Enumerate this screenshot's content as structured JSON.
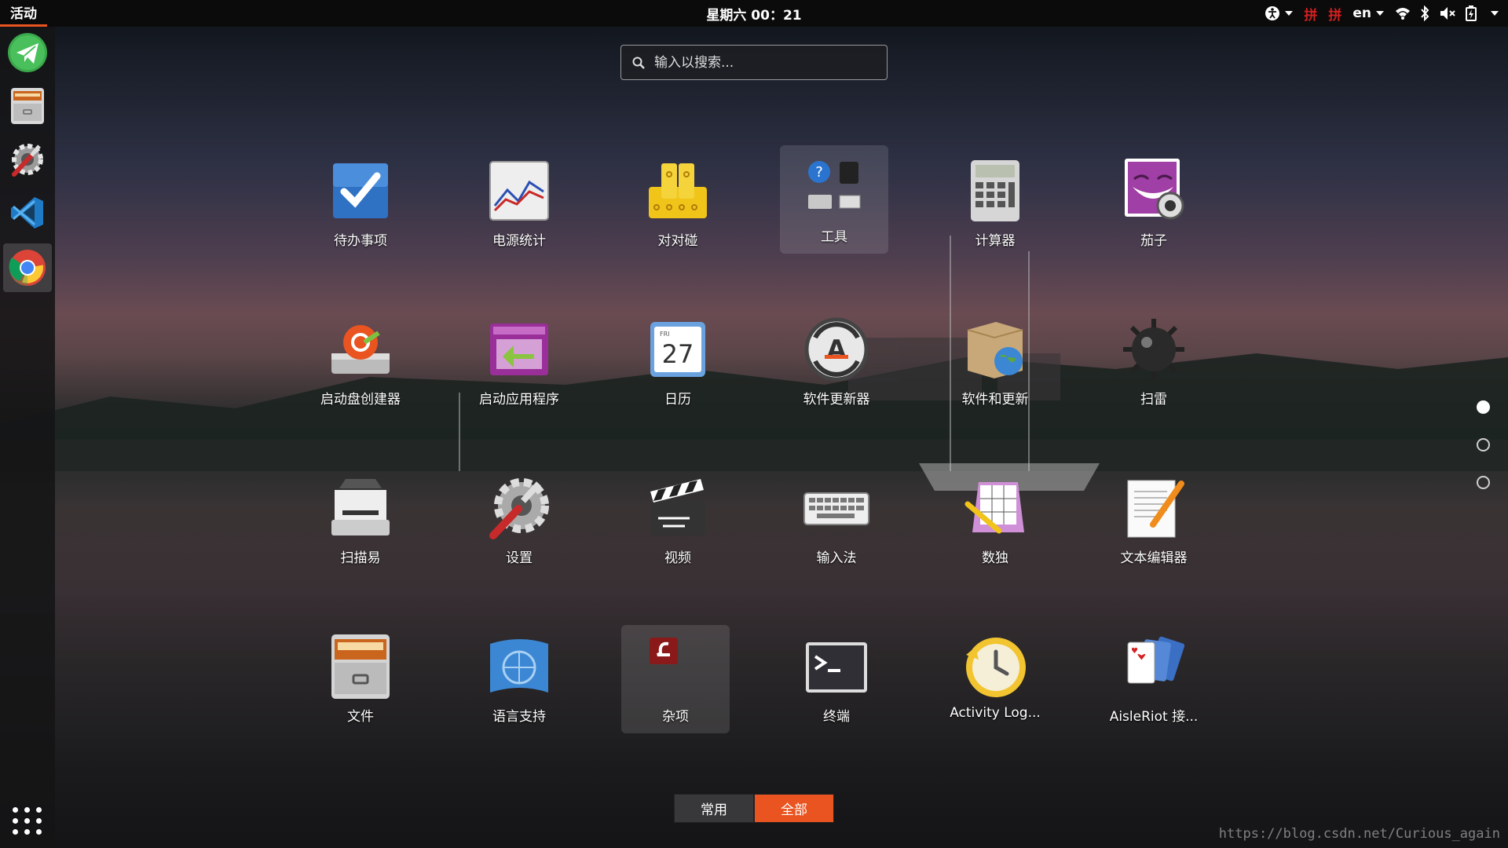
{
  "topbar": {
    "activities": "活动",
    "clock": "星期六 00：21",
    "pinyin_1": "拼",
    "pinyin_2": "拼",
    "language": "en"
  },
  "search": {
    "placeholder": "输入以搜索..."
  },
  "dock": {
    "items": [
      "telegram-icon",
      "file-cabinet-icon",
      "system-tools-icon",
      "vscode-icon",
      "chrome-icon"
    ],
    "active_index": 4
  },
  "apps": [
    {
      "label": "待办事项",
      "icon": "todo-icon"
    },
    {
      "label": "电源统计",
      "icon": "power-statistics-icon"
    },
    {
      "label": "对对碰",
      "icon": "swell-foop-icon"
    },
    {
      "label": "工具",
      "icon": "utilities-folder-icon",
      "highlighted": true
    },
    {
      "label": "计算器",
      "icon": "calculator-icon"
    },
    {
      "label": "茄子",
      "icon": "cheese-icon"
    },
    {
      "label": "启动盘创建器",
      "icon": "startup-disk-creator-icon"
    },
    {
      "label": "启动应用程序",
      "icon": "startup-applications-icon"
    },
    {
      "label": "日历",
      "icon": "calendar-icon",
      "day": "27",
      "weekday": "FRI"
    },
    {
      "label": "软件更新器",
      "icon": "software-updater-icon"
    },
    {
      "label": "软件和更新",
      "icon": "software-properties-icon"
    },
    {
      "label": "扫雷",
      "icon": "mines-icon"
    },
    {
      "label": "扫描易",
      "icon": "scanner-icon"
    },
    {
      "label": "设置",
      "icon": "settings-icon"
    },
    {
      "label": "视频",
      "icon": "video-clapperboard-icon"
    },
    {
      "label": "输入法",
      "icon": "keyboard-icon"
    },
    {
      "label": "数独",
      "icon": "sudoku-icon"
    },
    {
      "label": "文本编辑器",
      "icon": "text-editor-icon"
    },
    {
      "label": "文件",
      "icon": "files-icon"
    },
    {
      "label": "语言支持",
      "icon": "language-support-icon"
    },
    {
      "label": "杂项",
      "icon": "misc-folder-icon",
      "highlighted": true
    },
    {
      "label": "终端",
      "icon": "terminal-icon"
    },
    {
      "label": "Activity Log...",
      "icon": "activity-log-icon"
    },
    {
      "label": "AisleRiot 接...",
      "icon": "aisleriot-icon"
    }
  ],
  "pager": {
    "pages": 3,
    "current": 1
  },
  "tabs": {
    "frequent": "常用",
    "all": "全部",
    "active": "all"
  },
  "watermark": "https://blog.csdn.net/Curious_again",
  "colors": {
    "accent": "#e95420",
    "topbar": "#0b0b0b",
    "pinyin": "#d32020"
  }
}
